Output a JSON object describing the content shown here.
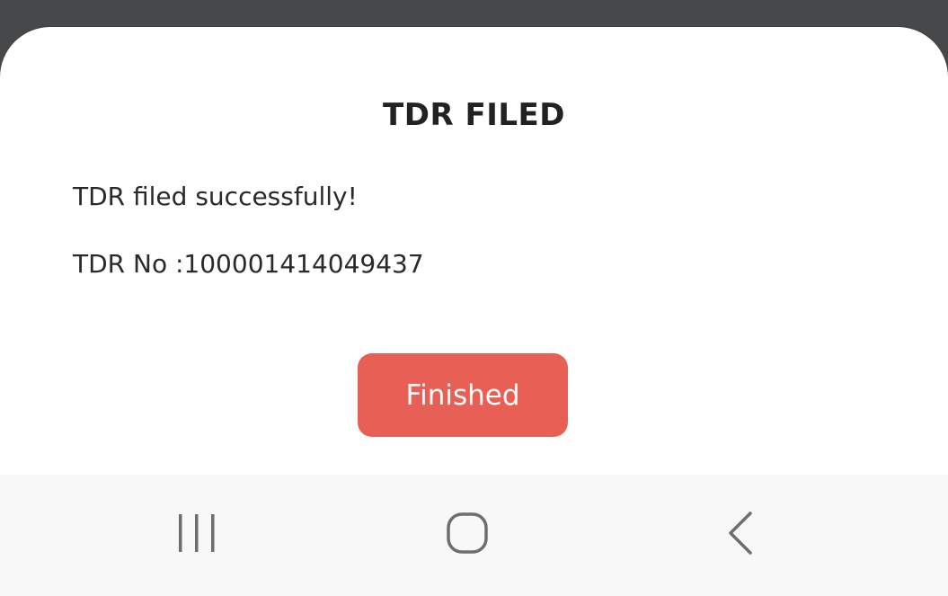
{
  "dialog": {
    "title": "TDR FILED",
    "message": "TDR filed successfully!",
    "tdr_line": "TDR No :100001414049437",
    "finished_label": "Finished"
  },
  "nav_bar": {
    "recents_icon": "recents-icon",
    "home_icon": "home-icon",
    "back_icon": "back-icon"
  },
  "colors": {
    "primary_button": "#e86055",
    "sheet_background": "#ffffff",
    "scrim": "#47484a",
    "nav_background": "#f8f8f8"
  }
}
